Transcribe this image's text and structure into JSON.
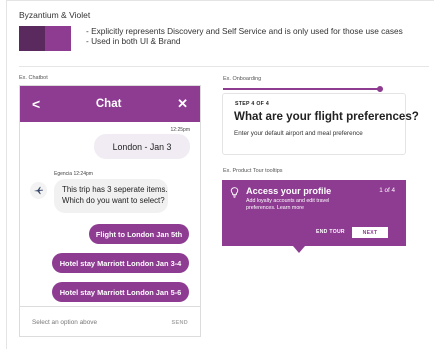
{
  "colors": {
    "byzantium": "#5a2a5e",
    "violet": "#8e3b92",
    "primary": "#8e3b92"
  },
  "header": {
    "title": "Byzantium & Violet",
    "notes": [
      "- Explicitly represents Discovery and Self Service and is only used for those use cases",
      "- Used in both UI & Brand"
    ]
  },
  "chatbot": {
    "example_label": "Ex. Chatbot",
    "title": "Chat",
    "back_icon": "chevron-left-icon",
    "close_icon": "close-icon",
    "user_message": {
      "time": "12:25pm",
      "text": "London - Jan 3"
    },
    "agent_message": {
      "meta": "Egencia 12:24pm",
      "avatar_icon": "airplane-icon",
      "lines": [
        "This trip has 3 seperate items.",
        "Which do you want to select?"
      ]
    },
    "options": [
      "Flight to London Jan 5th",
      "Hotel stay Marriott London Jan 3-4",
      "Hotel stay Marriott London Jan 5-6"
    ],
    "input_placeholder": "Select an option above",
    "send_label": "SEND"
  },
  "onboarding": {
    "example_label": "Ex. Onboarding",
    "progress": 0.98,
    "step": "STEP 4 OF 4",
    "question": "What are your flight preferences?",
    "description": "Enter your default airport and meal preference"
  },
  "tour": {
    "example_label": "Ex. Product Tour tooltips",
    "icon": "lightbulb-icon",
    "title": "Access your profile",
    "count": "1 of 4",
    "description_lines": [
      "Add loyalty accounts and edit travel",
      "preferences. Learn more"
    ],
    "end_label": "END TOUR",
    "next_label": "NEXT"
  }
}
